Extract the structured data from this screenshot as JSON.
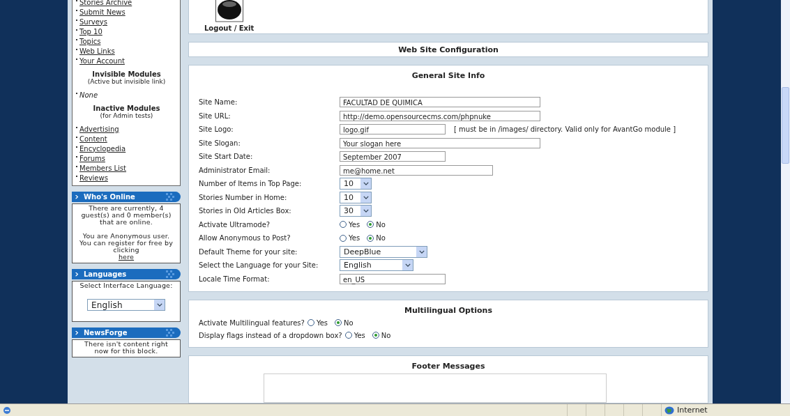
{
  "sidebar": {
    "modules": [
      "Stories Archive",
      "Submit News",
      "Surveys",
      "Top 10",
      "Topics",
      "Web Links",
      "Your Account"
    ],
    "groups": [
      {
        "title": "Invisible Modules",
        "subtitle": "(Active but invisible link)",
        "items": [
          {
            "label": "None",
            "kind": "plain"
          }
        ]
      },
      {
        "title": "Inactive Modules",
        "subtitle": "(for Admin tests)",
        "items": [
          {
            "label": "Advertising",
            "kind": "link"
          },
          {
            "label": "Content",
            "kind": "link"
          },
          {
            "label": "Encyclopedia",
            "kind": "link"
          },
          {
            "label": "Forums",
            "kind": "link"
          },
          {
            "label": "Members List",
            "kind": "link"
          },
          {
            "label": "Reviews",
            "kind": "link"
          }
        ]
      }
    ],
    "blocks": [
      {
        "kind": "text",
        "title": "Who's Online",
        "paragraphs": [
          "There are currently, 4 guest(s) and 0 member(s) that are online.",
          "You are Anonymous user. You can register for free by clicking"
        ],
        "link": "here"
      },
      {
        "kind": "select",
        "title": "Languages",
        "text": "Select Interface Language:",
        "value": "English"
      },
      {
        "kind": "text",
        "title": "NewsForge",
        "paragraphs": [
          "There isn't content right now for this block."
        ]
      }
    ]
  },
  "logout": {
    "label": "Logout / Exit"
  },
  "config_title": "Web Site Configuration",
  "sections": [
    {
      "kind": "form",
      "title": "General Site Info",
      "fields": [
        {
          "kind": "text",
          "label": "Site Name:",
          "value": "FACULTAD DE QUIMICA"
        },
        {
          "kind": "text",
          "label": "Site URL:",
          "value": "http://demo.opensourcecms.com/phpnuke"
        },
        {
          "kind": "text",
          "label": "Site Logo:",
          "value": "logo.gif",
          "note": "[ must be in /images/ directory. Valid only for AvantGo module ]"
        },
        {
          "kind": "text",
          "label": "Site Slogan:",
          "value": "Your slogan here"
        },
        {
          "kind": "text",
          "label": "Site Start Date:",
          "value": "September 2007"
        },
        {
          "kind": "text",
          "label": "Administrator Email:",
          "value": "me@home.net"
        },
        {
          "kind": "select",
          "label": "Number of Items in Top Page:",
          "value": "10"
        },
        {
          "kind": "select",
          "label": "Stories Number in Home:",
          "value": "10"
        },
        {
          "kind": "select",
          "label": "Stories in Old Articles Box:",
          "value": "30"
        },
        {
          "kind": "radio",
          "label": "Activate Ultramode?",
          "options": [
            {
              "label": "Yes",
              "selected": false
            },
            {
              "label": "No",
              "selected": true
            }
          ]
        },
        {
          "kind": "radio",
          "label": "Allow Anonymous to Post?",
          "options": [
            {
              "label": "Yes",
              "selected": false
            },
            {
              "label": "No",
              "selected": true
            }
          ]
        },
        {
          "kind": "select",
          "label": "Default Theme for your site:",
          "value": "DeepBlue"
        },
        {
          "kind": "select",
          "label": "Select the Language for your Site:",
          "value": "English"
        },
        {
          "kind": "text",
          "label": "Locale Time Format:",
          "value": "en_US"
        }
      ]
    },
    {
      "kind": "options",
      "title": "Multilingual Options",
      "fields": [
        {
          "kind": "radio",
          "label": "Activate Multilingual features?",
          "options": [
            {
              "label": "Yes",
              "selected": false
            },
            {
              "label": "No",
              "selected": true
            }
          ]
        },
        {
          "kind": "radio",
          "label": "Display flags instead of a dropdown box?",
          "options": [
            {
              "label": "Yes",
              "selected": false
            },
            {
              "label": "No",
              "selected": true
            }
          ]
        }
      ]
    },
    {
      "kind": "footer",
      "title": "Footer Messages",
      "fields": [
        {
          "kind": "textarea"
        }
      ]
    }
  ],
  "status_bar": {
    "zone": "Internet"
  }
}
